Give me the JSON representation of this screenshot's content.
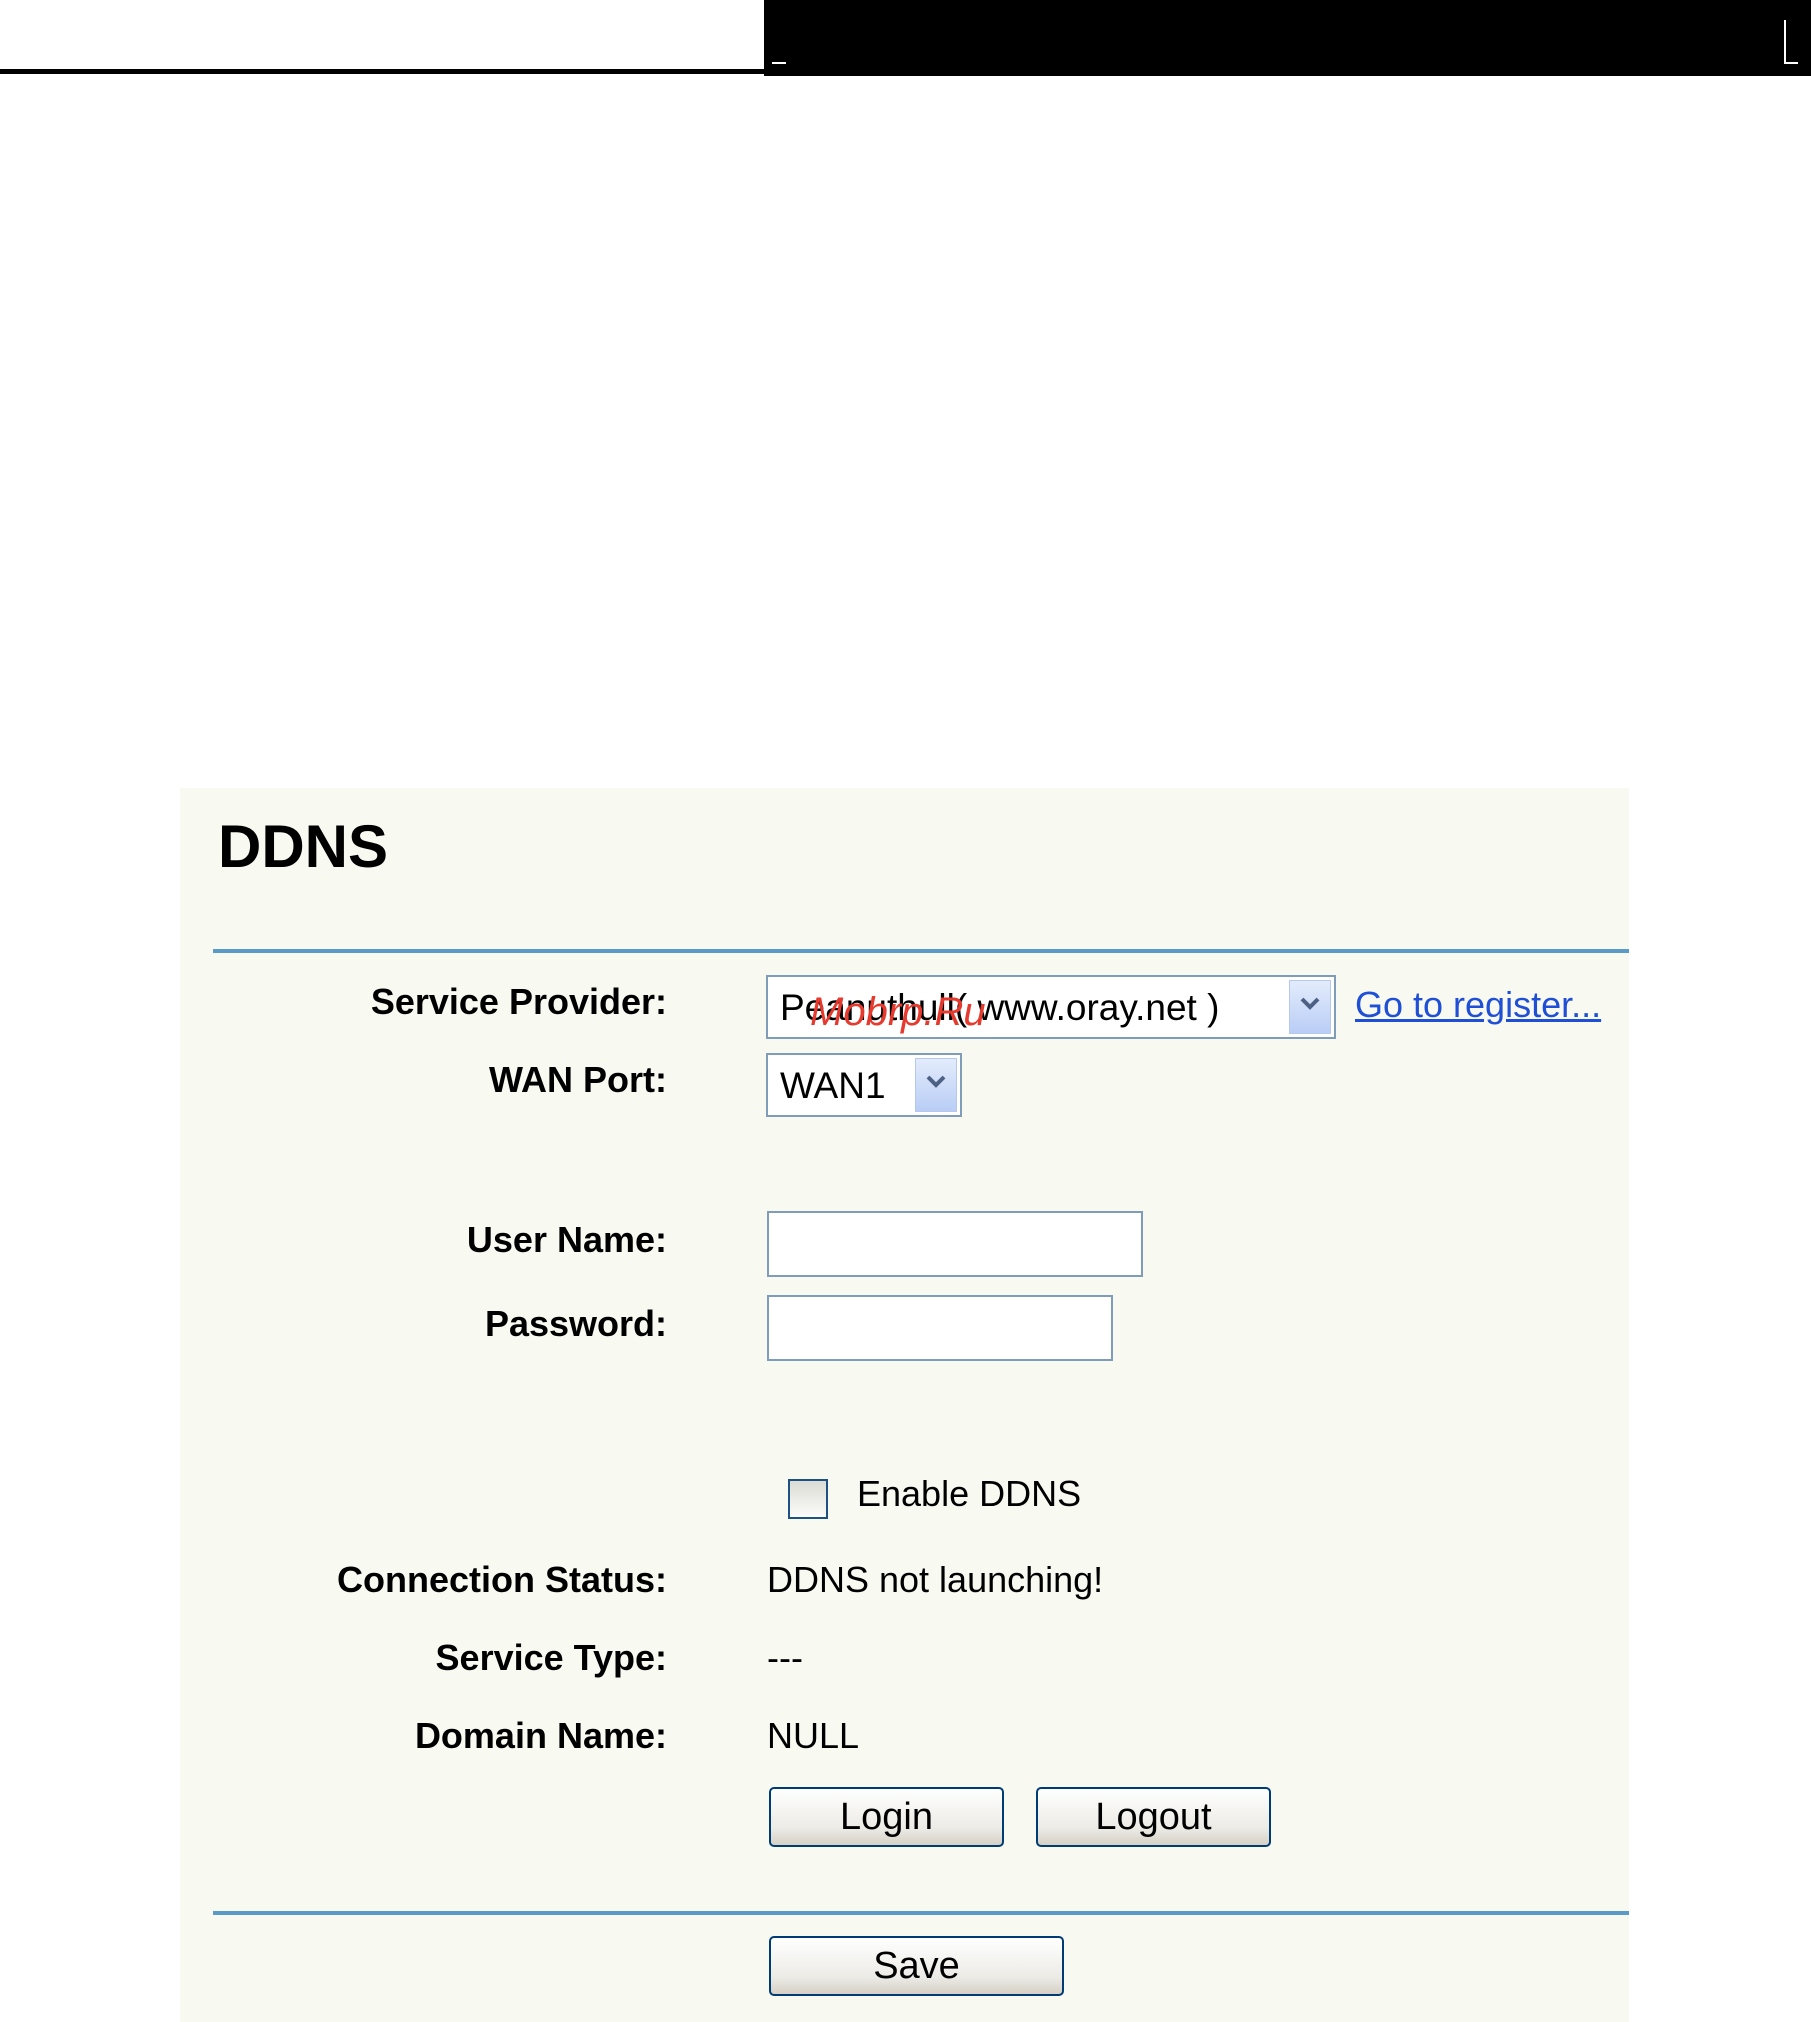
{
  "page": {
    "title": "DDNS"
  },
  "form": {
    "service_provider": {
      "label": "Service Provider:",
      "selected": "Peanuthull( www.oray.net )",
      "register_link": "Go to register..."
    },
    "wan_port": {
      "label": "WAN Port:",
      "selected": "WAN1"
    },
    "user_name": {
      "label": "User Name:",
      "value": ""
    },
    "password": {
      "label": "Password:",
      "value": ""
    },
    "enable_ddns": {
      "label": "Enable DDNS",
      "checked": false
    },
    "connection_status": {
      "label": "Connection Status:",
      "value": "DDNS not launching!"
    },
    "service_type": {
      "label": "Service Type:",
      "value": "---"
    },
    "domain_name": {
      "label": "Domain Name:",
      "value": "NULL"
    },
    "buttons": {
      "login": "Login",
      "logout": "Logout",
      "save": "Save"
    }
  },
  "watermark": "Mobrp.Ru",
  "colors": {
    "panel_bg": "#f8f9f1",
    "rule": "#5a9ac8",
    "link": "#1f4fd6",
    "watermark": "#e63a2e"
  }
}
